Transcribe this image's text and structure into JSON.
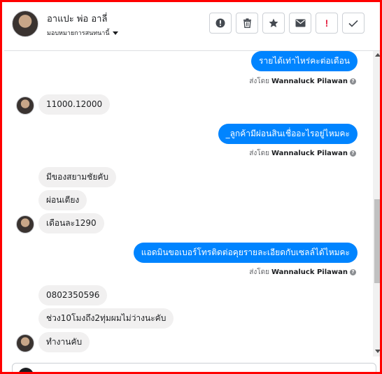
{
  "header": {
    "contact_name": "อาแปะ พ่อ อาลี่",
    "assign_label": "มอบหมายการสนทนานี้",
    "actions": [
      {
        "name": "alert-circle-icon",
        "label": "Mark as spam"
      },
      {
        "name": "trash-icon",
        "label": "Delete"
      },
      {
        "name": "star-icon",
        "label": "Star"
      },
      {
        "name": "envelope-icon",
        "label": "Mark unread"
      },
      {
        "name": "exclamation-icon",
        "label": "Follow up",
        "glyph": "!"
      },
      {
        "name": "checkmark-icon",
        "label": "Done"
      }
    ]
  },
  "messages": {
    "m1": "รายได้เท่าไหร่คะต่อเดือน",
    "m1_sent_prefix": "ส่งโดย",
    "m1_sender": "Wannaluck Pilawan",
    "m2": "11000.12000",
    "m3": "_ลูกค้ามีผ่อนสินเชื่ออะไรอยู่ไหมคะ",
    "m3_sent_prefix": "ส่งโดย",
    "m3_sender": "Wannaluck Pilawan",
    "m4": "มีของสยามชัยคับ",
    "m5": "ผ่อนเตียง",
    "m6": "เดือนละ1290",
    "m7": "แอดมินขอเบอร์โทรติดต่อคุยรายละเอียดกับเซลล์ได้ไหมคะ",
    "m7_sent_prefix": "ส่งโดย",
    "m7_sender": "Wannaluck Pilawan",
    "m8": "0802350596",
    "m9": "ช่วง10โมงถึง2ทุ่มผมไม่ว่างนะคับ",
    "m10": "ทำงานคับ",
    "help_glyph": "?"
  },
  "colors": {
    "outgoing_bubble": "#0084ff",
    "incoming_bubble": "#f1f0f0",
    "frame_border": "#ff0000",
    "follow_up_red": "#e41e3f"
  }
}
